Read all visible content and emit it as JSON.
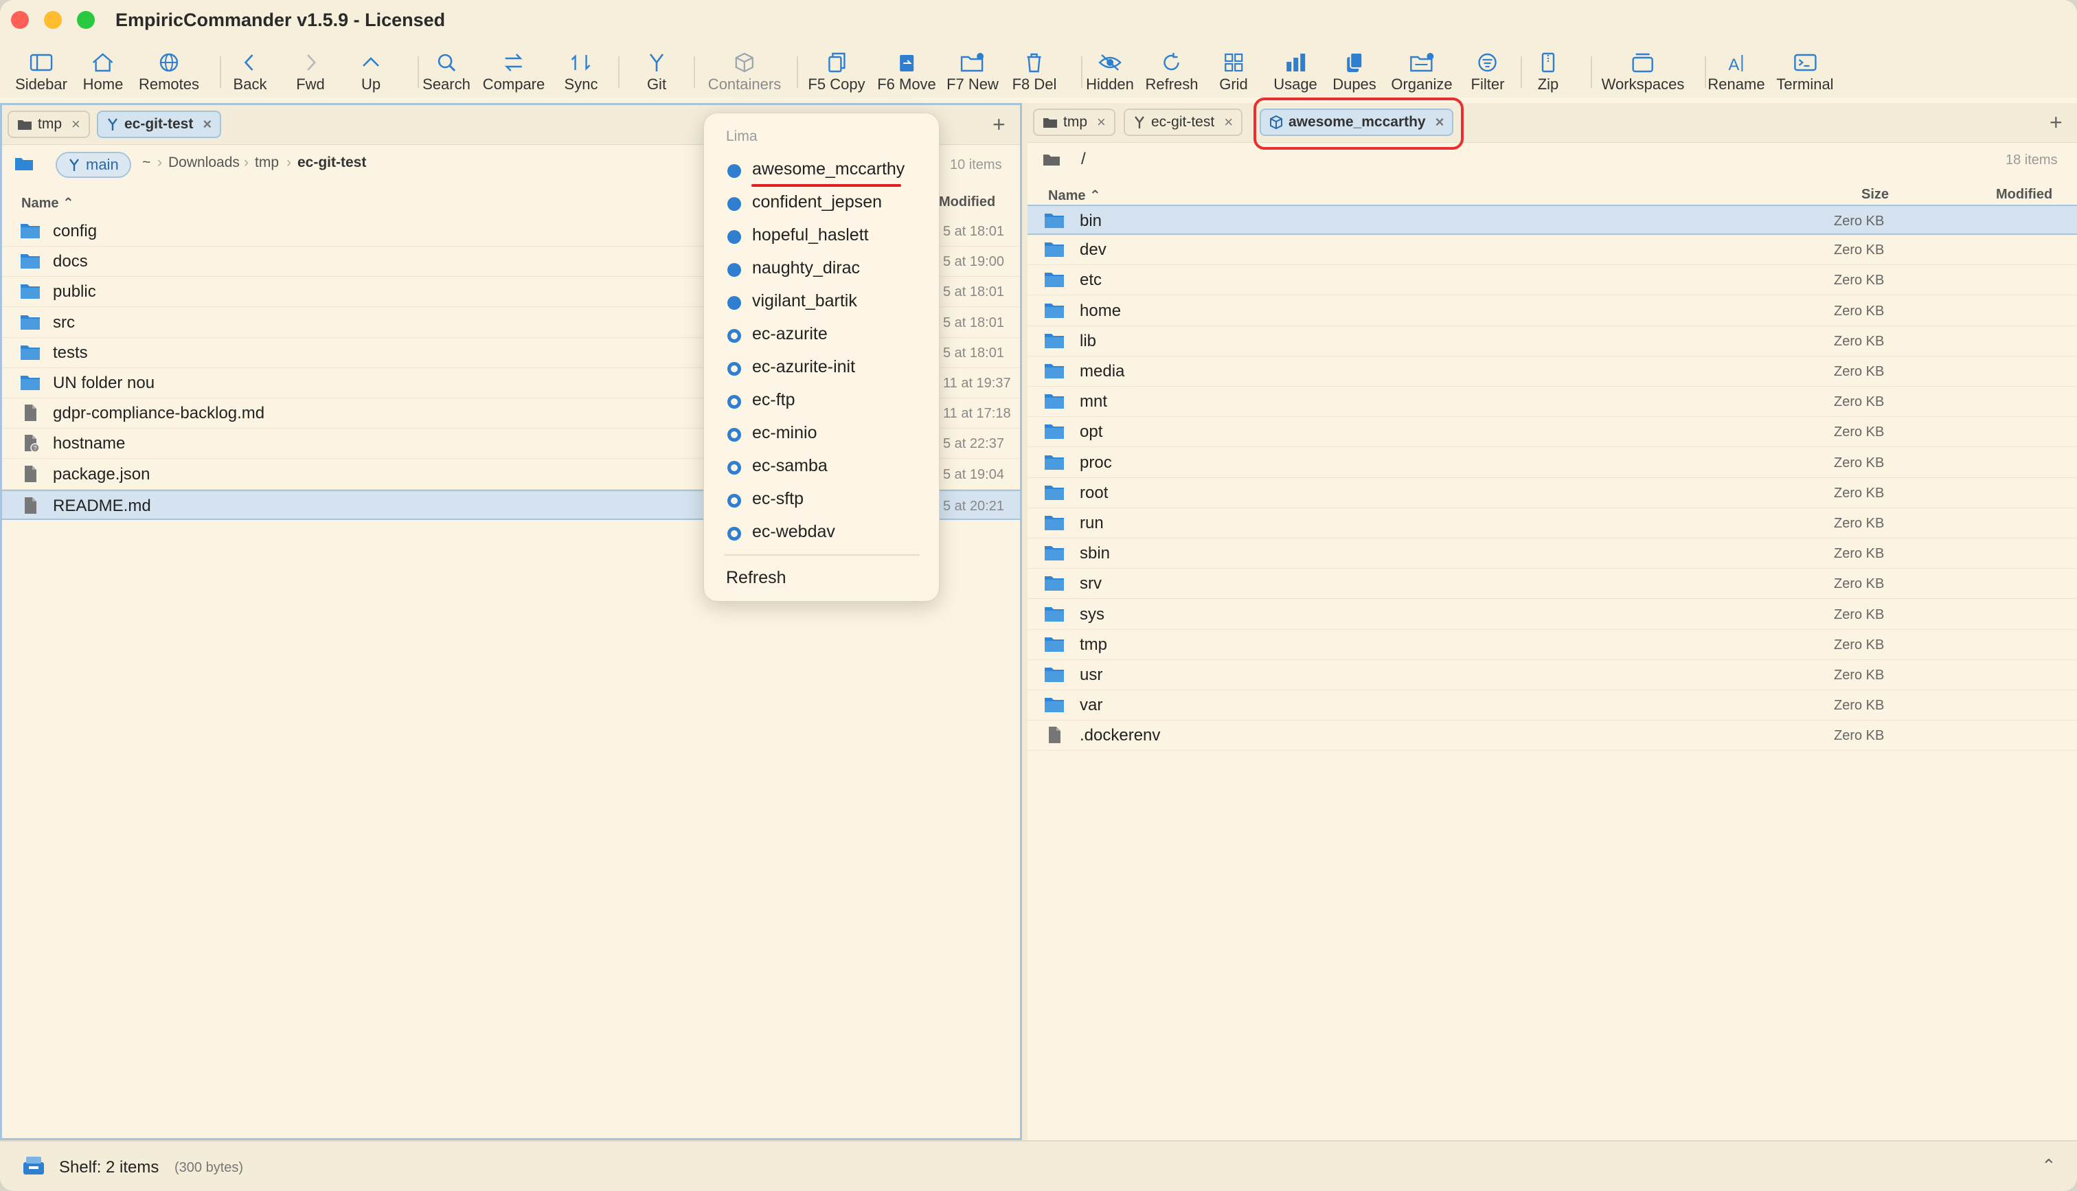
{
  "window": {
    "title": "EmpiricCommander v1.5.9 - Licensed"
  },
  "toolbar": [
    {
      "label": "Sidebar",
      "icon": "sidebar-icon"
    },
    {
      "label": "Home",
      "icon": "home-icon"
    },
    {
      "label": "Remotes",
      "icon": "globe-icon"
    },
    {
      "label": "Back",
      "icon": "chevron-left-icon"
    },
    {
      "label": "Fwd",
      "icon": "chevron-right-icon"
    },
    {
      "label": "Up",
      "icon": "chevron-up-icon"
    },
    {
      "label": "Search",
      "icon": "search-icon"
    },
    {
      "label": "Compare",
      "icon": "compare-icon"
    },
    {
      "label": "Sync",
      "icon": "sync-icon"
    },
    {
      "label": "Git",
      "icon": "git-branch-icon"
    },
    {
      "label": "Containers",
      "icon": "cube-icon"
    },
    {
      "label": "F5 Copy",
      "icon": "copy-icon"
    },
    {
      "label": "F6 Move",
      "icon": "move-icon"
    },
    {
      "label": "F7 New",
      "icon": "new-folder-icon"
    },
    {
      "label": "F8 Del",
      "icon": "trash-icon"
    },
    {
      "label": "Hidden",
      "icon": "eye-slash-icon"
    },
    {
      "label": "Refresh",
      "icon": "refresh-icon"
    },
    {
      "label": "Grid",
      "icon": "grid-icon"
    },
    {
      "label": "Usage",
      "icon": "bar-chart-icon"
    },
    {
      "label": "Dupes",
      "icon": "duplicate-icon"
    },
    {
      "label": "Organize",
      "icon": "organize-icon"
    },
    {
      "label": "Filter",
      "icon": "filter-icon"
    },
    {
      "label": "Zip",
      "icon": "zip-icon"
    },
    {
      "label": "Workspaces",
      "icon": "workspaces-icon"
    },
    {
      "label": "Rename",
      "icon": "rename-icon"
    },
    {
      "label": "Terminal",
      "icon": "terminal-icon"
    }
  ],
  "left_pane": {
    "tabs": [
      {
        "label": "tmp",
        "icon": "folder-icon"
      },
      {
        "label": "ec-git-test",
        "icon": "git-branch-icon",
        "active": true
      }
    ],
    "branch": "main",
    "breadcrumb": [
      "~",
      "Downloads",
      "tmp",
      "ec-git-test"
    ],
    "item_count": "10 items",
    "columns": {
      "name": "Name",
      "modified": "Modified"
    },
    "rows": [
      {
        "name": "config",
        "type": "folder",
        "modified": "5 at 18:01"
      },
      {
        "name": "docs",
        "type": "folder",
        "modified": "5 at 19:00"
      },
      {
        "name": "public",
        "type": "folder",
        "modified": "5 at 18:01"
      },
      {
        "name": "src",
        "type": "folder",
        "modified": "5 at 18:01"
      },
      {
        "name": "tests",
        "type": "folder",
        "modified": "5 at 18:01"
      },
      {
        "name": "UN folder nou",
        "type": "folder",
        "modified": "11 at 19:37"
      },
      {
        "name": "gdpr-compliance-backlog.md",
        "type": "file",
        "modified": "11 at 17:18"
      },
      {
        "name": "hostname",
        "type": "file-badge",
        "modified": "5 at 22:37"
      },
      {
        "name": "package.json",
        "type": "file",
        "modified": "5 at 19:04"
      },
      {
        "name": "README.md",
        "type": "file",
        "modified": "5 at 20:21",
        "selected": true
      }
    ]
  },
  "containers_menu": {
    "header": "Lima",
    "items": [
      {
        "label": "awesome_mccarthy",
        "state": "running"
      },
      {
        "label": "confident_jepsen",
        "state": "running"
      },
      {
        "label": "hopeful_haslett",
        "state": "running"
      },
      {
        "label": "naughty_dirac",
        "state": "running"
      },
      {
        "label": "vigilant_bartik",
        "state": "running"
      },
      {
        "label": "ec-azurite",
        "state": "stopped"
      },
      {
        "label": "ec-azurite-init",
        "state": "stopped"
      },
      {
        "label": "ec-ftp",
        "state": "stopped"
      },
      {
        "label": "ec-minio",
        "state": "stopped"
      },
      {
        "label": "ec-samba",
        "state": "stopped"
      },
      {
        "label": "ec-sftp",
        "state": "stopped"
      },
      {
        "label": "ec-webdav",
        "state": "stopped"
      }
    ],
    "refresh_label": "Refresh"
  },
  "right_pane": {
    "tabs": [
      {
        "label": "tmp",
        "icon": "folder-icon"
      },
      {
        "label": "ec-git-test",
        "icon": "git-branch-icon"
      },
      {
        "label": "awesome_mccarthy",
        "icon": "container-icon",
        "active": true
      }
    ],
    "path": "/",
    "item_count": "18 items",
    "columns": {
      "name": "Name",
      "size": "Size",
      "modified": "Modified"
    },
    "rows": [
      {
        "name": "bin",
        "type": "folder",
        "size": "Zero KB",
        "selected": true
      },
      {
        "name": "dev",
        "type": "folder",
        "size": "Zero KB"
      },
      {
        "name": "etc",
        "type": "folder",
        "size": "Zero KB"
      },
      {
        "name": "home",
        "type": "folder",
        "size": "Zero KB"
      },
      {
        "name": "lib",
        "type": "folder",
        "size": "Zero KB"
      },
      {
        "name": "media",
        "type": "folder",
        "size": "Zero KB"
      },
      {
        "name": "mnt",
        "type": "folder",
        "size": "Zero KB"
      },
      {
        "name": "opt",
        "type": "folder",
        "size": "Zero KB"
      },
      {
        "name": "proc",
        "type": "folder",
        "size": "Zero KB"
      },
      {
        "name": "root",
        "type": "folder",
        "size": "Zero KB"
      },
      {
        "name": "run",
        "type": "folder",
        "size": "Zero KB"
      },
      {
        "name": "sbin",
        "type": "folder",
        "size": "Zero KB"
      },
      {
        "name": "srv",
        "type": "folder",
        "size": "Zero KB"
      },
      {
        "name": "sys",
        "type": "folder",
        "size": "Zero KB"
      },
      {
        "name": "tmp",
        "type": "folder",
        "size": "Zero KB"
      },
      {
        "name": "usr",
        "type": "folder",
        "size": "Zero KB"
      },
      {
        "name": "var",
        "type": "folder",
        "size": "Zero KB"
      },
      {
        "name": ".dockerenv",
        "type": "file",
        "size": "Zero KB"
      }
    ]
  },
  "shelf": {
    "label": "Shelf: 2 items",
    "size": "(300 bytes)"
  },
  "colors": {
    "accent": "#2f7fd0",
    "folder": "#2f86d6",
    "selection": "#d4e3ef",
    "highlight": "#e83030",
    "background": "#fbf4e3"
  }
}
